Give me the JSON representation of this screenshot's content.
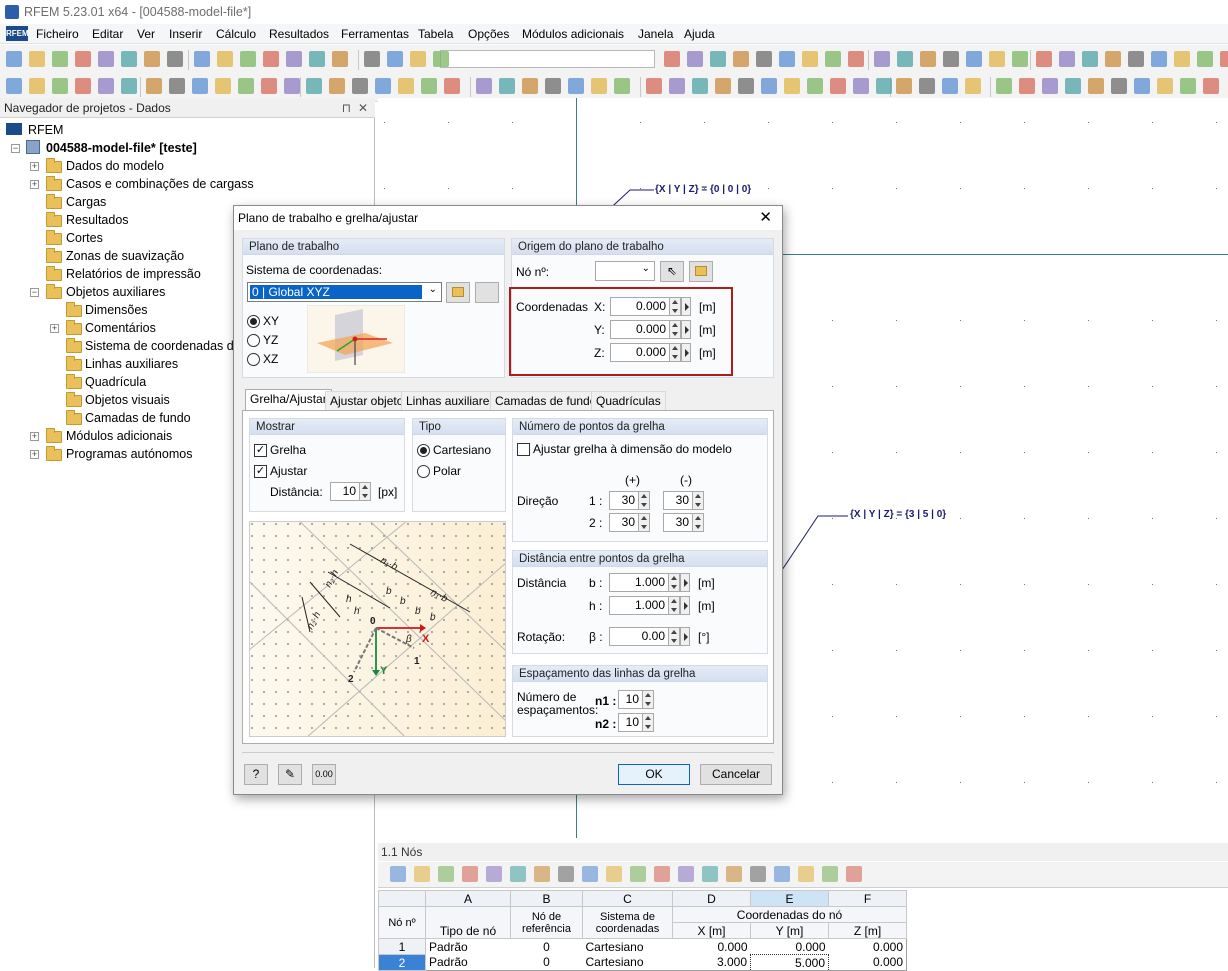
{
  "window": {
    "title": "RFEM 5.23.01 x64 - [004588-model-file*]"
  },
  "menu": [
    "Ficheiro",
    "Editar",
    "Ver",
    "Inserir",
    "Cálculo",
    "Resultados",
    "Ferramentas",
    "Tabela",
    "Opções",
    "Módulos adicionais",
    "Janela",
    "Ajuda"
  ],
  "navigator": {
    "title": "Navegador de projetos - Dados",
    "root": "RFEM",
    "project": "004588-model-file* [teste]",
    "items": [
      "Dados do modelo",
      "Casos e combinações de cargass",
      "Cargas",
      "Resultados",
      "Cortes",
      "Zonas de suavização",
      "Relatórios de impressão",
      "Objetos auxiliares"
    ],
    "subitems": [
      "Dimensões",
      "Comentários",
      "Sistema de coordenadas def",
      "Linhas auxiliares",
      "Quadrícula",
      "Objetos visuais",
      "Camadas de fundo"
    ],
    "tail": [
      "Módulos adicionais",
      "Programas autónomos"
    ]
  },
  "viewport": {
    "label1": "{X | Y | Z} = {0 | 0 | 0}",
    "label2": "{X | Y | Z} = {3 | 5 | 0}"
  },
  "dialog": {
    "title": "Plano de trabalho e grelha/ajustar",
    "workplane": {
      "header": "Plano de trabalho",
      "cs_label": "Sistema de coordenadas:",
      "cs_value": "0 | Global XYZ",
      "planes": [
        "XY",
        "YZ",
        "XZ"
      ],
      "selected": "XY"
    },
    "origin": {
      "header": "Origem do plano de trabalho",
      "node_label": "Nó nº:",
      "coords_label": "Coordenadas",
      "x_label": "X:",
      "y_label": "Y:",
      "z_label": "Z:",
      "x": "0.000",
      "y": "0.000",
      "z": "0.000",
      "unit": "[m]"
    },
    "tabs": [
      "Grelha/Ajustar",
      "Ajustar objeto",
      "Linhas auxiliares",
      "Camadas de fundo",
      "Quadrículas"
    ],
    "show": {
      "header": "Mostrar",
      "grid": "Grelha",
      "snap": "Ajustar",
      "dist_label": "Distância:",
      "dist": "10",
      "dist_unit": "[px]"
    },
    "type": {
      "header": "Tipo",
      "cart": "Cartesiano",
      "polar": "Polar"
    },
    "points": {
      "header": "Número de pontos da grelha",
      "fit": "Ajustar grelha à dimensão do modelo",
      "plus": "(+)",
      "minus": "(-)",
      "dir_label": "Direção",
      "r1": "1 :",
      "r2": "2 :",
      "v1p": "30",
      "v1m": "30",
      "v2p": "30",
      "v2m": "30"
    },
    "distance": {
      "header": "Distância entre pontos da grelha",
      "dist_label": "Distância",
      "b_label": "b :",
      "h_label": "h :",
      "b": "1.000",
      "h": "1.000",
      "unit": "[m]",
      "rot_label": "Rotação:",
      "beta_label": "β :",
      "beta": "0.00",
      "beta_unit": "[°]"
    },
    "spacing": {
      "header": "Espaçamento das linhas da grelha",
      "label": "Número de espaçamentos:",
      "n1_label": "n1 :",
      "n2_label": "n2 :",
      "n1": "10",
      "n2": "10"
    },
    "ok": "OK",
    "cancel": "Cancelar"
  },
  "table": {
    "title": "1.1 Nós",
    "cols": [
      "A",
      "B",
      "C",
      "D",
      "E",
      "F"
    ],
    "h_no": "Nó nº",
    "h_type": "Tipo de nó",
    "h_ref": "Nó de referência",
    "h_cs": "Sistema de coordenadas",
    "h_coords": "Coordenadas do nó",
    "h_x": "X [m]",
    "h_y": "Y [m]",
    "h_z": "Z [m]",
    "rows": [
      {
        "no": "1",
        "type": "Padrão",
        "ref": "0",
        "cs": "Cartesiano",
        "x": "0.000",
        "y": "0.000",
        "z": "0.000"
      },
      {
        "no": "2",
        "type": "Padrão",
        "ref": "0",
        "cs": "Cartesiano",
        "x": "3.000",
        "y": "5.000",
        "z": "0.000"
      }
    ]
  }
}
